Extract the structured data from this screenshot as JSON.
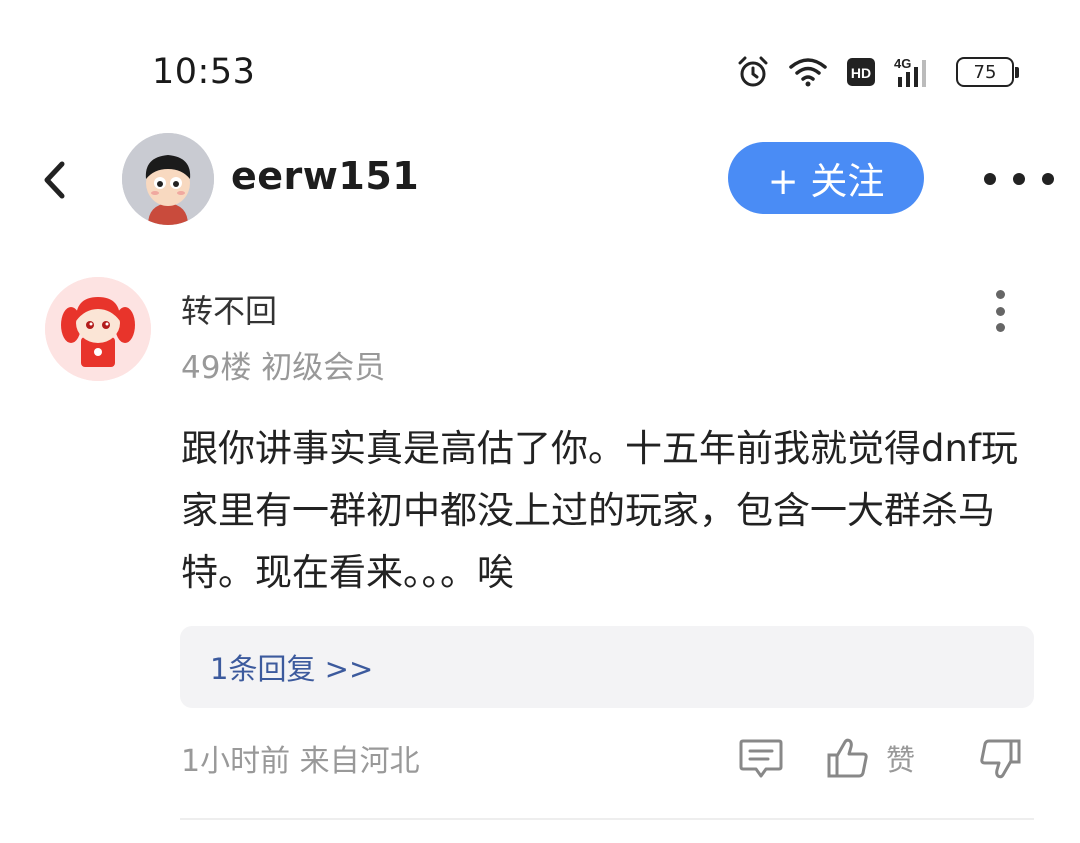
{
  "status_bar": {
    "time": "10:53",
    "icons": [
      "alarm-icon",
      "wifi-icon",
      "hd-icon",
      "4g-signal-icon"
    ],
    "network_label": "4G",
    "hd_label": "HD",
    "battery": "75"
  },
  "header": {
    "username": "eerw151",
    "follow_label": "+ 关注"
  },
  "post": {
    "author": "转不回",
    "meta": "49楼 初级会员",
    "content": "跟你讲事实真是高估了你。十五年前我就觉得dnf玩家里有一群初中都没上过的玩家，包含一大群杀马特。现在看来。。。唉",
    "reply_link": "1条回复 >>",
    "footer": "1小时前 来自河北",
    "like_label": "赞"
  },
  "colors": {
    "accent": "#4a8cf5",
    "reply_link": "#3c5a9d",
    "muted": "#999999"
  }
}
